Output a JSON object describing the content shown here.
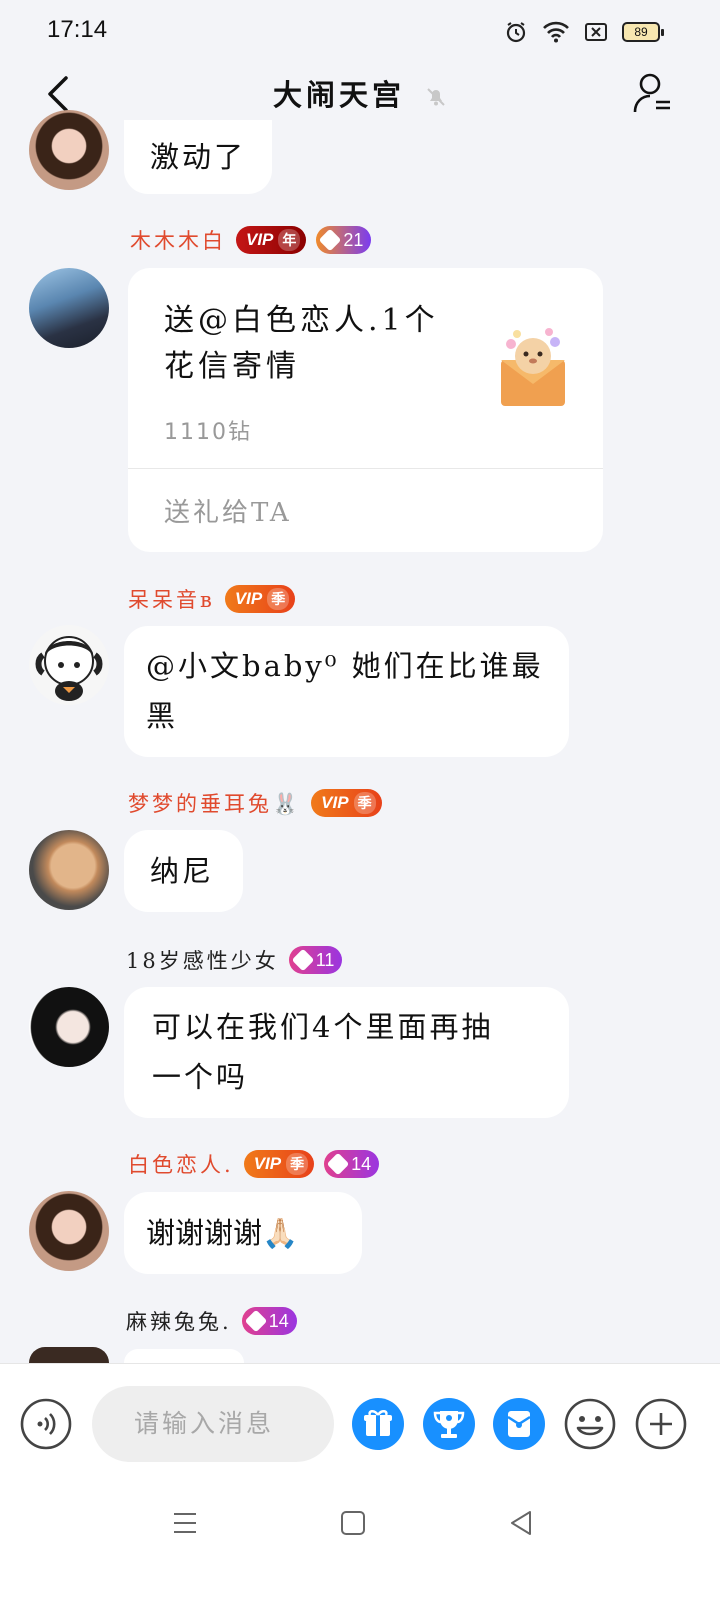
{
  "status_bar": {
    "time": "17:14",
    "battery": "89"
  },
  "header": {
    "title": "大闹天宫"
  },
  "messages": [
    {
      "text": "激动了"
    },
    {
      "sender": "木木木白",
      "vip": "VIP",
      "vip_suffix": "年",
      "level": "21",
      "gift": {
        "line1": "送@白色恋人.1个",
        "line2": "花信寄情",
        "price": "1110钻",
        "action": "送礼给TA"
      }
    },
    {
      "sender": "呆呆音ʙ",
      "vip": "VIP",
      "vip_suffix": "季",
      "line1": "@小文baby⁰ 她们在比谁最",
      "line2": "黑"
    },
    {
      "sender": "梦梦的垂耳兔🐰",
      "vip": "VIP",
      "vip_suffix": "季",
      "text": "纳尼"
    },
    {
      "sender": "18岁感性少女",
      "level": "11",
      "line1": "可以在我们4个里面再抽",
      "line2": "一个吗"
    },
    {
      "sender": "白色恋人.",
      "vip": "VIP",
      "vip_suffix": "季",
      "level": "14",
      "text": "谢谢谢谢🙏🏻"
    },
    {
      "sender": "麻辣兔兔.",
      "level": "14"
    }
  ],
  "composer": {
    "placeholder": "请输入消息"
  },
  "colors": {
    "accent_blue": "#1890ff",
    "name_red": "#e04a2e"
  }
}
